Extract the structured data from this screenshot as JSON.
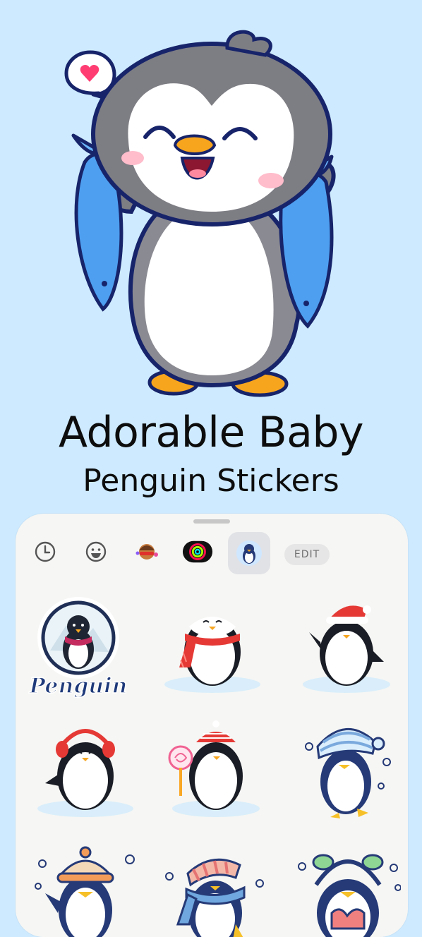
{
  "hero": {
    "title_line1": "Adorable Baby",
    "title_line2": "Penguin Stickers"
  },
  "keyboard": {
    "tabs": [
      {
        "icon": "recent-clock-icon",
        "selected": false
      },
      {
        "icon": "emoji-face-icon",
        "selected": false
      },
      {
        "icon": "memoji-avatar-icon",
        "selected": false
      },
      {
        "icon": "activity-rings-icon",
        "selected": false
      },
      {
        "icon": "penguin-pack-icon",
        "selected": true
      }
    ],
    "edit_label": "EDIT",
    "badge_text": "Penguin",
    "stickers": [
      "penguin-logo-sticker",
      "penguin-red-scarf-sticker",
      "penguin-santa-hat-sticker",
      "penguin-earmuffs-sticker",
      "penguin-lollipop-sticker",
      "penguin-striped-beanie-sticker",
      "penguin-orange-beanie-sticker",
      "penguin-blue-scarf-sticker",
      "penguin-headphones-sticker"
    ]
  },
  "colors": {
    "background": "#cdeaff",
    "sheet": "#f6f6f4",
    "penguin_gray": "#7d7d84",
    "penguin_navy": "#253a77",
    "beak_orange": "#f6a623",
    "fish_blue": "#4e9ff0"
  }
}
